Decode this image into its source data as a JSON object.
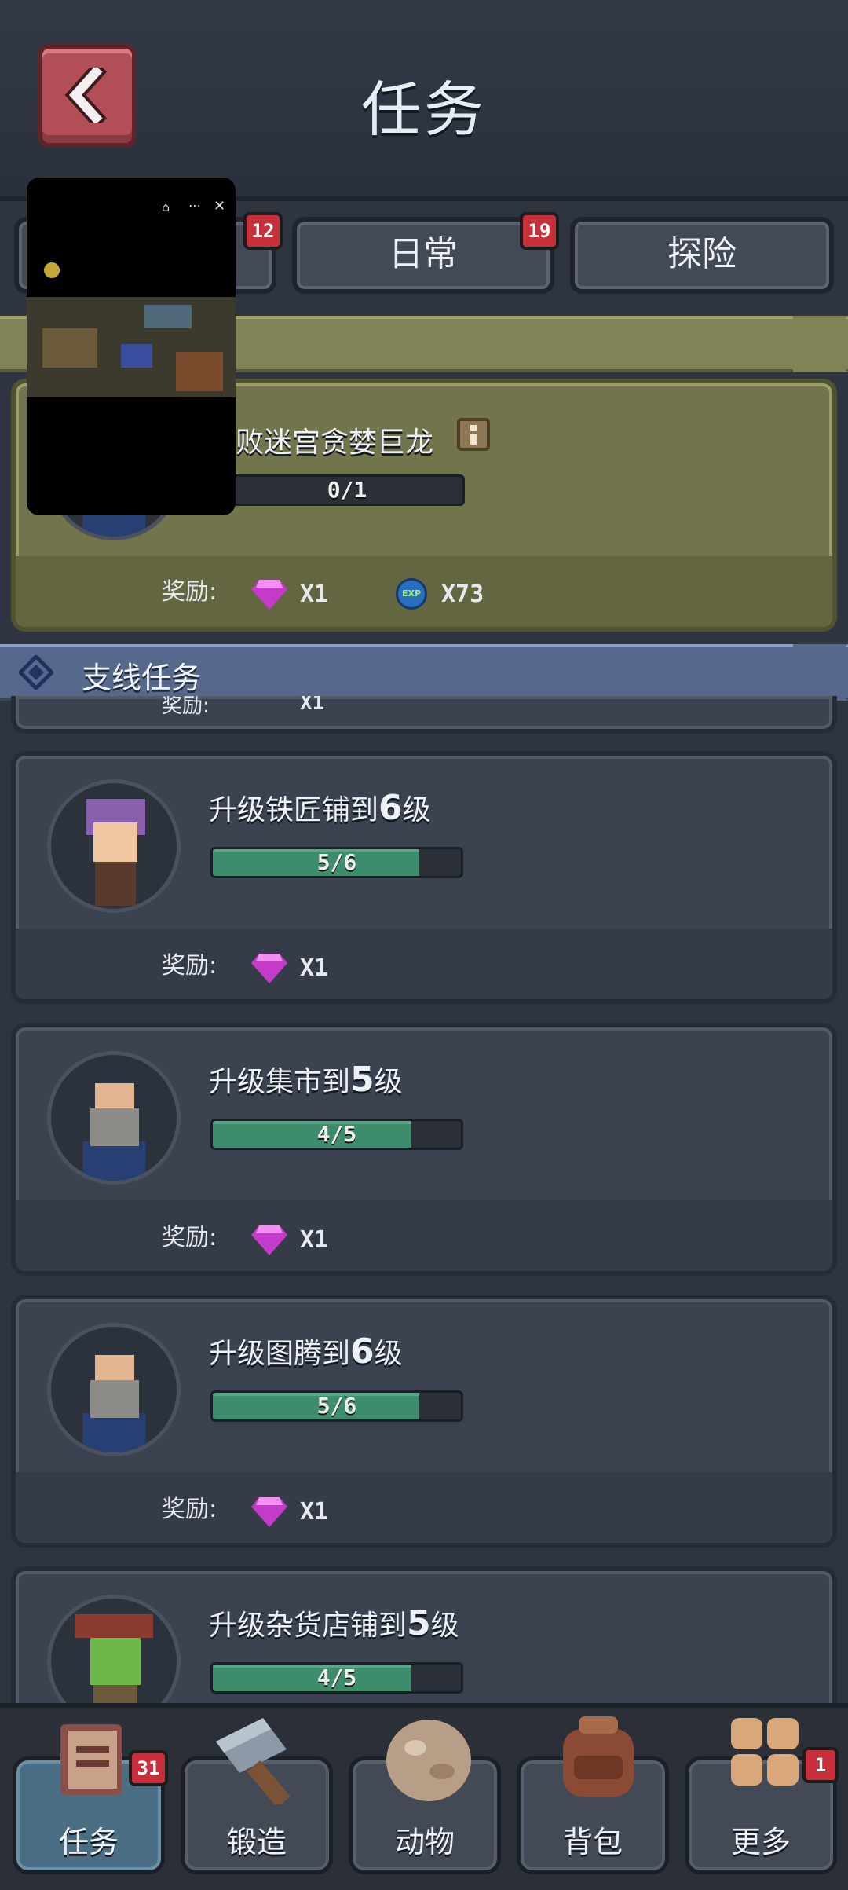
{
  "header": {
    "title": "任务",
    "back_icon": "chevron-left-icon"
  },
  "tabs": [
    {
      "label": "",
      "badge": "12"
    },
    {
      "label": "日常",
      "badge": "19"
    },
    {
      "label": "探险",
      "badge": ""
    }
  ],
  "main_task": {
    "name": "败迷宫贪婪巨龙",
    "progress_text": "0/1",
    "progress": 0,
    "reward_label": "奖励:",
    "rewards": [
      {
        "icon": "gem-icon",
        "qty": "X1"
      },
      {
        "icon": "exp-icon",
        "qty": "X73"
      }
    ],
    "exp_icon_text": "EXP"
  },
  "side_section": {
    "title": "支线任务"
  },
  "partial_card": {
    "reward_label": "奖励:",
    "qty": "X1"
  },
  "tasks": [
    {
      "name_prefix": "升级铁匠铺到",
      "level": "6",
      "name_suffix": "级",
      "progress_text": "5/6",
      "progress": 0.833,
      "reward_label": "奖励:",
      "qty": "X1"
    },
    {
      "name_prefix": "升级集市到",
      "level": "5",
      "name_suffix": "级",
      "progress_text": "4/5",
      "progress": 0.8,
      "reward_label": "奖励:",
      "qty": "X1"
    },
    {
      "name_prefix": "升级图腾到",
      "level": "6",
      "name_suffix": "级",
      "progress_text": "5/6",
      "progress": 0.833,
      "reward_label": "奖励:",
      "qty": "X1"
    },
    {
      "name_prefix": "升级杂货店铺到",
      "level": "5",
      "name_suffix": "级",
      "progress_text": "4/5",
      "progress": 0.8,
      "reward_label": "",
      "qty": ""
    }
  ],
  "bottom_nav": [
    {
      "label": "任务",
      "badge": "31",
      "icon": "quest-book-icon",
      "active": true
    },
    {
      "label": "锻造",
      "badge": "",
      "icon": "hammer-icon",
      "active": false
    },
    {
      "label": "动物",
      "badge": "",
      "icon": "egg-icon",
      "active": false
    },
    {
      "label": "背包",
      "badge": "",
      "icon": "backpack-icon",
      "active": false
    },
    {
      "label": "更多",
      "badge": "1",
      "icon": "grid-more-icon",
      "active": false
    }
  ],
  "pip": {
    "controls": [
      "home-icon",
      "more-icon",
      "close-icon"
    ]
  },
  "colors": {
    "bg": "#2e3440",
    "card": "#3b4350",
    "progress": "#3d8d6d",
    "badge": "#c7303b",
    "main_banner": "#7f8355",
    "side_banner": "#56698c"
  }
}
